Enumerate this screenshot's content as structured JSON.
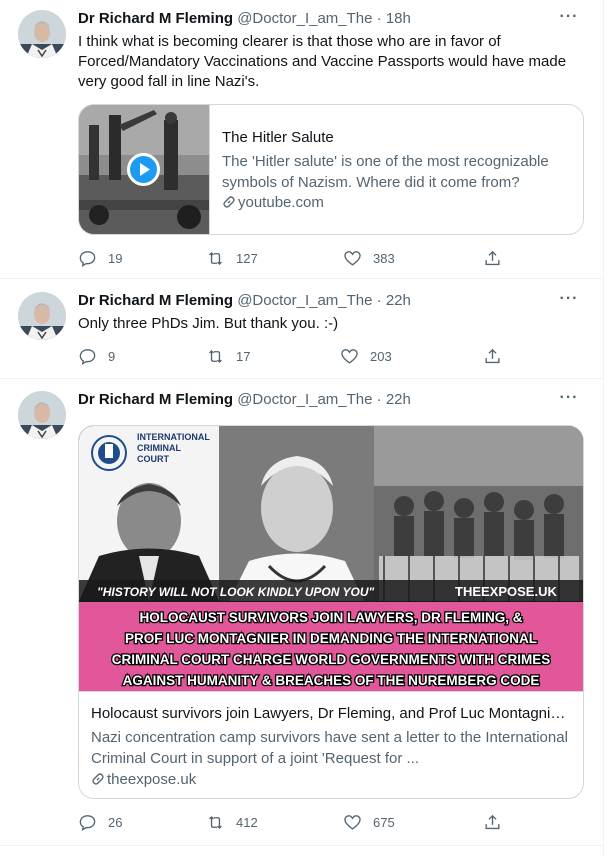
{
  "tweets": [
    {
      "author_name": "Dr Richard M Fleming",
      "handle": "@Doctor_I_am_The",
      "separator": "·",
      "time": "18h",
      "text": "I think what is becoming clearer is that those who are in favor of Forced/Mandatory Vaccinations and Vaccine Passports would have made very good fall in line Nazi's.",
      "card": {
        "title": "The Hitler Salute",
        "description": "The 'Hitler salute' is one of the most recognizable symbols of Nazism. Where did it come from?",
        "domain": "youtube.com",
        "thumbnail_icon": "play-icon"
      },
      "replies": "19",
      "retweets": "127",
      "likes": "383"
    },
    {
      "author_name": "Dr Richard M Fleming",
      "handle": "@Doctor_I_am_The",
      "separator": "·",
      "time": "22h",
      "text": "Only three PhDs Jim. But thank you. :-)",
      "replies": "9",
      "retweets": "17",
      "likes": "203"
    },
    {
      "author_name": "Dr Richard M Fleming",
      "handle": "@Doctor_I_am_The",
      "separator": "·",
      "time": "22h",
      "card": {
        "image": {
          "logo_line1": "INTERNATIONAL",
          "logo_line2": "CRIMINAL",
          "logo_line3": "COURT",
          "quote": "\"HISTORY WILL NOT LOOK KINDLY UPON YOU\"",
          "source_mark": "THEEXPOSE.UK",
          "headline_line1": "HOLOCAUST SURVIVORS JOIN LAWYERS, DR FLEMING, &",
          "headline_line2": "PROF LUC MONTAGNIER IN DEMANDING THE INTERNATIONAL",
          "headline_line3": "CRIMINAL COURT CHARGE WORLD GOVERNMENTS WITH CRIMES",
          "headline_line4": "AGAINST HUMANITY & BREACHES OF THE NUREMBERG CODE",
          "banner_color": "#e2579a"
        },
        "title": "Holocaust survivors join Lawyers, Dr Fleming, and Prof Luc Montagnier in demanding the International Criminal Court charge World Governments with crimes against humanity",
        "description": "Nazi concentration camp survivors have sent a letter to the International Criminal Court in support of a joint 'Request for ...",
        "domain": "theexpose.uk"
      },
      "replies": "26",
      "retweets": "412",
      "likes": "675"
    }
  ],
  "icons": {
    "more": "more-icon",
    "reply": "reply-icon",
    "retweet": "retweet-icon",
    "like": "heart-icon",
    "share": "share-icon",
    "link": "link-icon"
  },
  "colors": {
    "text": "#0f1419",
    "muted": "#536471",
    "border": "#cfd9de",
    "play": "#1d9bf0"
  }
}
